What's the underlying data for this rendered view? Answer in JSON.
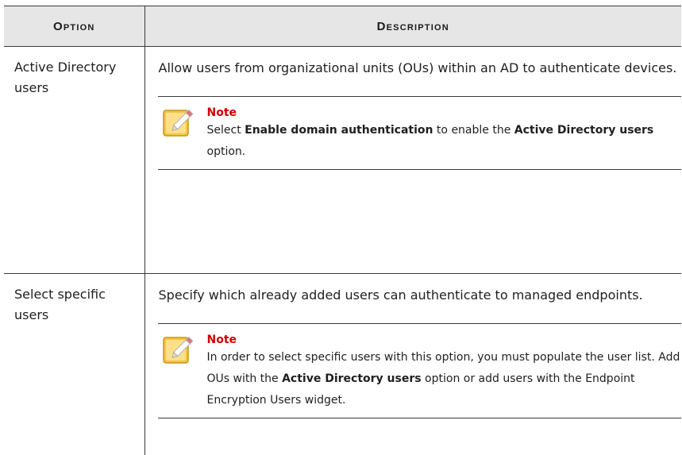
{
  "table": {
    "headers": {
      "option": "Option",
      "description": "Description"
    },
    "rows": [
      {
        "option": "Active Directory users",
        "description": "Allow users from organizational units (OUs) within an AD to authenticate devices.",
        "note": {
          "title": "Note",
          "text_1": "Select ",
          "bold_1": "Enable domain authentication",
          "text_2": " to enable the ",
          "bold_2": "Active Directory users",
          "text_3": " option."
        }
      },
      {
        "option": "Select specific users",
        "description": "Specify which already added users can authenticate to managed endpoints.",
        "note": {
          "title": "Note",
          "text_1": "In order to select specific users with this option, you must populate the user list. Add OUs with the ",
          "bold_1": "Active Directory users",
          "text_2": " option or add users with the Endpoint Encryption Users widget."
        }
      }
    ]
  },
  "icons": {
    "note_icon": "note-pencil-icon"
  },
  "colors": {
    "header_bg": "#e6e6e6",
    "note_title": "#d10000",
    "icon_fill": "#f5c542"
  }
}
